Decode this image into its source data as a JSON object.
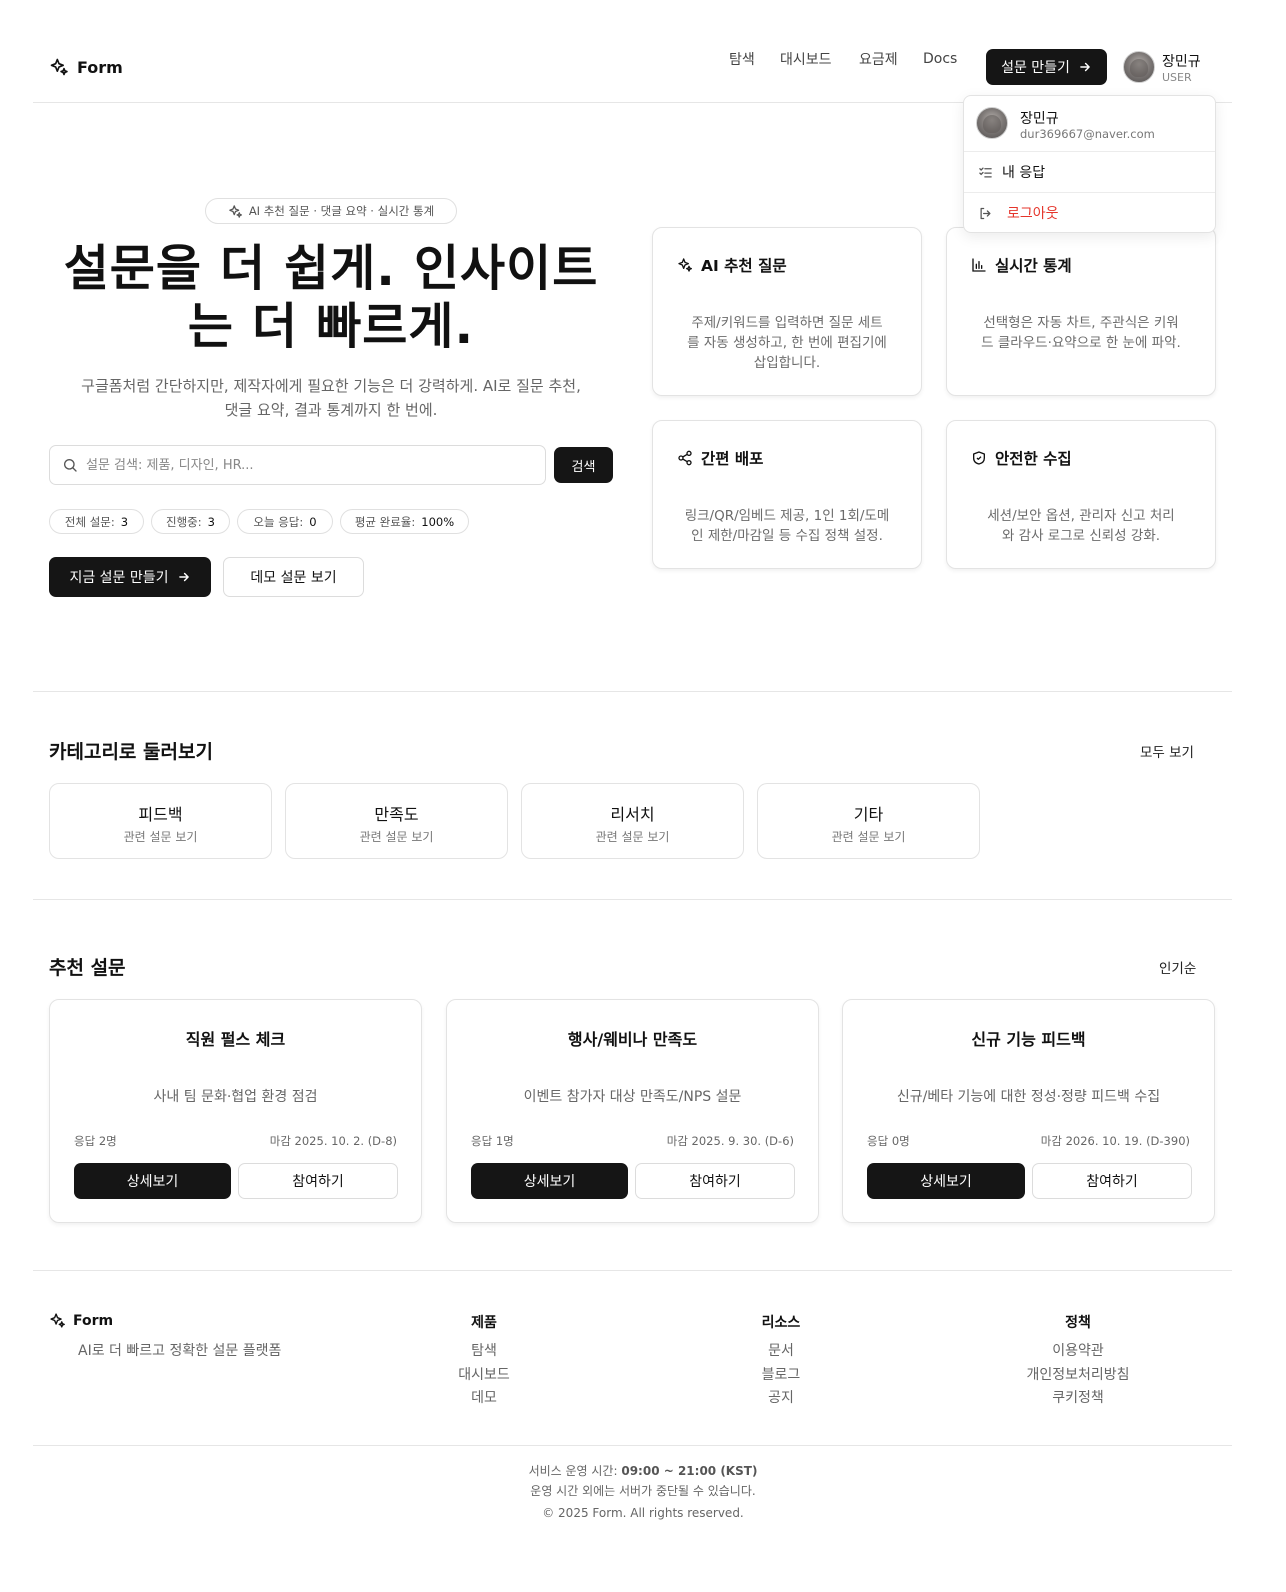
{
  "header": {
    "brand": "Form",
    "nav": [
      "탐색",
      "대시보드",
      "요금제",
      "Docs"
    ],
    "cta": "설문 만들기",
    "user_name": "장민규",
    "user_role": "USER"
  },
  "dropdown": {
    "name": "장민규",
    "email": "dur369667@naver.com",
    "my_responses": "내 응답",
    "logout": "로그아웃",
    "logout_color": "#e5352b"
  },
  "hero": {
    "pill": "AI 추천 질문 · 댓글 요약 · 실시간 통계",
    "title_line1": "설문을 더 쉽게. 인사이트",
    "title_line2": "는 더 빠르게.",
    "subtitle_line1": "구글폼처럼 간단하지만, 제작자에게 필요한 기능은 더 강력하게. AI로 질문 추천,",
    "subtitle_line2": "댓글 요약, 결과 통계까지 한 번에.",
    "search_placeholder": "설문 검색: 제품, 디자인, HR...",
    "search_button": "검색",
    "stats": [
      {
        "label": "전체 설문:",
        "value": "3"
      },
      {
        "label": "진행중:",
        "value": "3"
      },
      {
        "label": "오늘 응답:",
        "value": "0"
      },
      {
        "label": "평균 완료율:",
        "value": "100%"
      }
    ],
    "primary_button": "지금 설문 만들기",
    "secondary_button": "데모 설문 보기"
  },
  "features": [
    {
      "icon": "sparkles-icon",
      "title": "AI 추천 질문",
      "desc": [
        "주제/키워드를 입력하면 질문 세트",
        "를 자동 생성하고, 한 번에 편집기에",
        "삽입합니다."
      ]
    },
    {
      "icon": "bar-chart-icon",
      "title": "실시간 통계",
      "desc": [
        "선택형은 자동 차트, 주관식은 키워",
        "드 클라우드·요약으로 한 눈에 파악."
      ]
    },
    {
      "icon": "share-icon",
      "title": "간편 배포",
      "desc": [
        "링크/QR/임베드 제공, 1인 1회/도메",
        "인 제한/마감일 등 수집 정책 설정."
      ]
    },
    {
      "icon": "shield-check-icon",
      "title": "안전한 수집",
      "desc": [
        "세션/보안 옵션, 관리자 신고 처리",
        "와 감사 로그로 신뢰성 강화."
      ]
    }
  ],
  "categories": {
    "title": "카테고리로 둘러보기",
    "see_all": "모두 보기",
    "items": [
      {
        "name": "피드백",
        "sub": "관련 설문 보기"
      },
      {
        "name": "만족도",
        "sub": "관련 설문 보기"
      },
      {
        "name": "리서치",
        "sub": "관련 설문 보기"
      },
      {
        "name": "기타",
        "sub": "관련 설문 보기"
      }
    ]
  },
  "recommended": {
    "title": "추천 설문",
    "sort": "인기순",
    "items": [
      {
        "title": "직원 펄스 체크",
        "desc": "사내 팀 문화·협업 환경 점검",
        "responses": "응답 2명",
        "deadline": "마감 2025. 10. 2. (D-8)",
        "detail": "상세보기",
        "join": "참여하기"
      },
      {
        "title": "행사/웨비나 만족도",
        "desc": "이벤트 참가자 대상 만족도/NPS 설문",
        "responses": "응답 1명",
        "deadline": "마감 2025. 9. 30. (D-6)",
        "detail": "상세보기",
        "join": "참여하기"
      },
      {
        "title": "신규 기능 피드백",
        "desc": "신규/베타 기능에 대한 정성·정량 피드백 수집",
        "responses": "응답 0명",
        "deadline": "마감 2026. 10. 19. (D-390)",
        "detail": "상세보기",
        "join": "참여하기"
      }
    ]
  },
  "footer": {
    "brand": "Form",
    "tagline": "AI로 더 빠르고 정확한 설문 플랫폼",
    "columns": [
      {
        "title": "제품",
        "links": [
          "탐색",
          "대시보드",
          "데모"
        ]
      },
      {
        "title": "리소스",
        "links": [
          "문서",
          "블로그",
          "공지"
        ]
      },
      {
        "title": "정책",
        "links": [
          "이용약관",
          "개인정보처리방침",
          "쿠키정책"
        ]
      }
    ],
    "hours_label": "서비스 운영 시간:",
    "hours_value": "09:00 ~ 21:00 (KST)",
    "notice": "운영 시간 외에는 서버가 중단될 수 있습니다.",
    "copyright": "© 2025 Form. All rights reserved."
  }
}
